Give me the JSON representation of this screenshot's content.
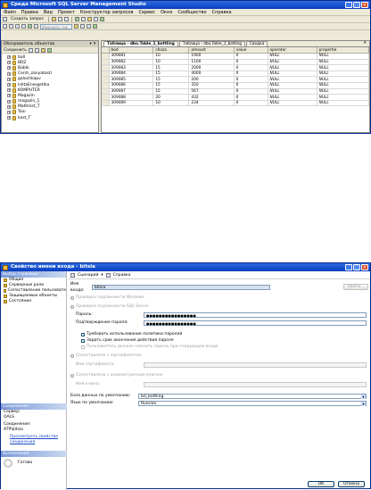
{
  "ssms": {
    "title": "Среда Microsoft SQL Server Management Studio",
    "menu": [
      "Файл",
      "Правка",
      "Вид",
      "Проект",
      "Конструктор запросов",
      "Сервис",
      "Окно",
      "Сообщество",
      "Справка"
    ],
    "new_query_label": "Создать запрос",
    "change_type_label": "Изменить тип",
    "object_explorer": {
      "title": "Обозреватель объектов",
      "connect_label": "Соединить",
      "items": [
        "ball",
        "BD2",
        "Babik",
        "Centr_zanyatosti",
        "galochkapv",
        "IshtaEnergetika",
        "KOMPUTER",
        "Magazin",
        "magazin_1",
        "MathInst_T",
        "Taxi",
        "kost_T"
      ]
    },
    "tabs": [
      "Таблица - dbo.Table_1_bottling",
      "Таблица - dbo.Table_1_botting",
      "Сводка"
    ],
    "grid": {
      "columns": [
        "bod",
        "choza",
        "amount",
        "value",
        "operator",
        "propertie"
      ],
      "rows": [
        [
          "309081",
          "10",
          "1900",
          "0",
          "NULL",
          "NULL"
        ],
        [
          "309082",
          "10",
          "1100",
          "0",
          "NULL",
          "NULL"
        ],
        [
          "309083",
          "15",
          "2000",
          "0",
          "NULL",
          "NULL"
        ],
        [
          "309084",
          "15",
          "4000",
          "0",
          "NULL",
          "NULL"
        ],
        [
          "309085",
          "15",
          "200",
          "0",
          "NULL",
          "NULL"
        ],
        [
          "309086",
          "15",
          "350",
          "0",
          "NULL",
          "NULL"
        ],
        [
          "309087",
          "15",
          "567",
          "0",
          "NULL",
          "NULL"
        ],
        [
          "309088",
          "20",
          "432",
          "0",
          "NULL",
          "NULL"
        ],
        [
          "309089",
          "10",
          "234",
          "0",
          "NULL",
          "NULL"
        ]
      ]
    }
  },
  "dialog": {
    "title": "Свойство имени входа - bitsia",
    "select_page_header": "Выбор страницы",
    "pages": [
      "Общие",
      "Серверные роли",
      "Сопоставление пользовате",
      "Защищаемые объекты",
      "Состояние"
    ],
    "connection_header": "Соединение",
    "server_label": "Сервер:",
    "server_value": "OALS",
    "connection_label": "Соединение:",
    "connection_value": "ATP\\bitsia",
    "view_props_link": "Просмотреть свойства соединения",
    "progress_header": "Выполнение",
    "progress_status": "Готово",
    "toolbar_script": "Сценарий",
    "toolbar_help": "Справка",
    "login_name_label": "Имя входа:",
    "login_name_value": "bitsia",
    "search_button": "Найти...",
    "win_auth_label": "Проверка подлинности Windows",
    "sql_auth_label": "Проверка подлинности SQL Server",
    "password_label": "Пароль:",
    "password_value": "●●●●●●●●●●●●●●●●",
    "confirm_label": "Подтверждение пароля:",
    "confirm_value": "●●●●●●●●●●●●●●●●",
    "enforce_policy_label": "Требовать использование политики паролей",
    "enforce_expiry_label": "Задать срок окончания действия пароля",
    "must_change_label": "Пользователь должен сменить пароль при следующем входе",
    "cert_map_label": "Сопоставлено с сертификатом",
    "cert_name_label": "Имя сертификата:",
    "asym_map_label": "Сопоставлено с асимметричным ключом",
    "key_name_label": "Имя ключа:",
    "default_db_label": "База данных по умолчанию:",
    "default_db_value": "bd_bottling",
    "default_lang_label": "Язык по умолчанию:",
    "default_lang_value": "Russian",
    "ok_button": "ОК",
    "cancel_button": "Отмена"
  }
}
